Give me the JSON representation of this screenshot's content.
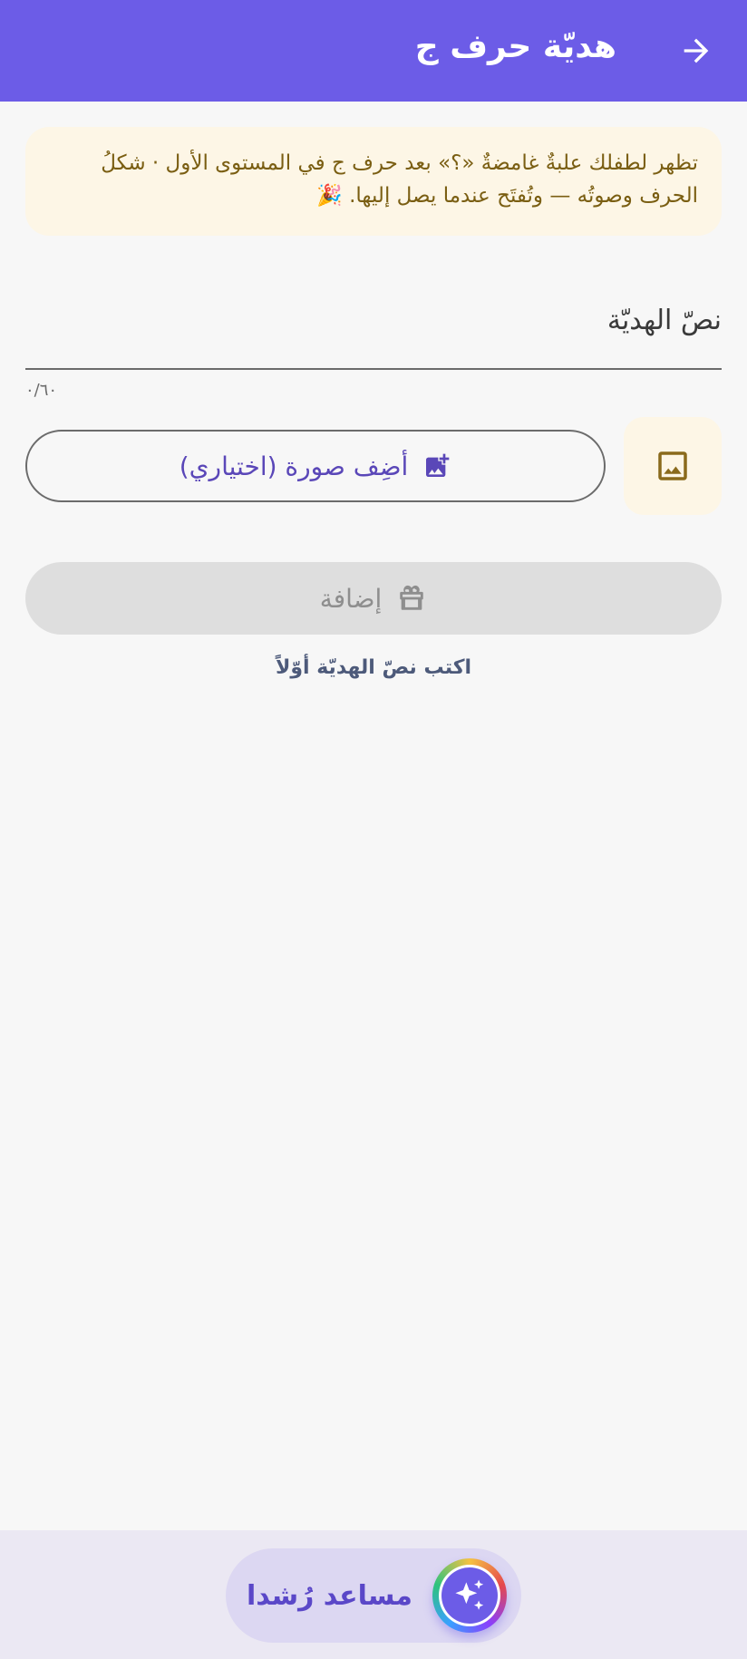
{
  "header": {
    "title": "هديّة حرف ج",
    "back_icon": "arrow-forward-icon"
  },
  "banner": {
    "text": "تظهر لطفلك علبةٌ غامضةٌ «؟» بعد حرف ج في المستوى الأول · شكلُ الحرف وصوتُه — وتُفتَح عندما يصل إليها. 🎉"
  },
  "gift_text": {
    "placeholder": "نصّ الهديّة",
    "value": "",
    "counter": "٠/٦٠"
  },
  "photo": {
    "preview_icon": "image-icon",
    "add_label": "أضِف صورة (اختياري)",
    "add_icon": "add-photo-icon"
  },
  "submit": {
    "label": "إضافة",
    "icon": "gift-icon",
    "enabled": false,
    "hint": "اكتب نصّ الهديّة أوّلاً"
  },
  "assistant": {
    "label": "مساعد رُشدا",
    "icon": "sparkles-icon"
  },
  "colors": {
    "primary": "#6c5ce7",
    "banner_bg": "#fdf6e6",
    "banner_text": "#7a5e12",
    "disabled_bg": "#dedede",
    "hint_text": "#4d5a7a"
  }
}
